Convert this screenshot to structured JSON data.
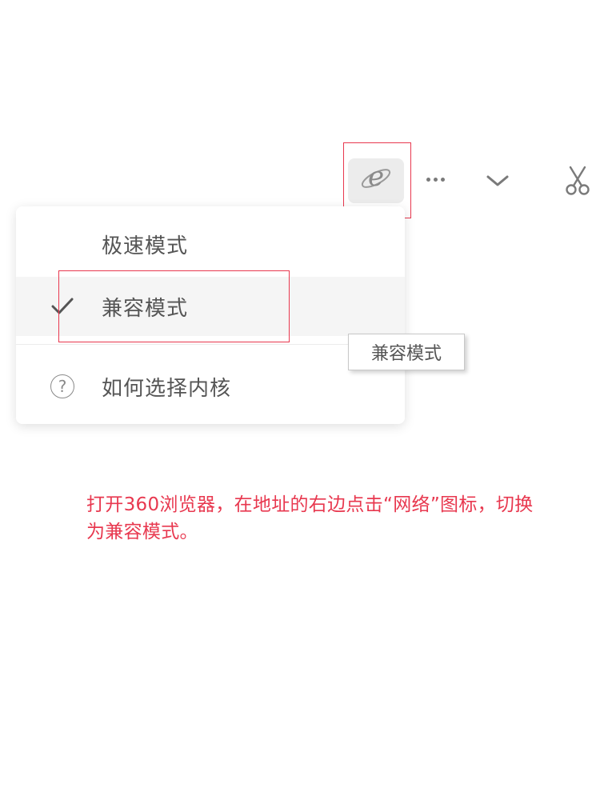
{
  "toolbar": {
    "ie_icon": "ie-compat-icon",
    "more_icon": "more-dots-icon",
    "dropdown_icon": "chevron-down-icon",
    "scissors_icon": "scissors-icon"
  },
  "menu": {
    "items": [
      {
        "label": "极速模式",
        "checked": false
      },
      {
        "label": "兼容模式",
        "checked": true,
        "icon": "checkmark-icon"
      },
      {
        "label": "如何选择内核",
        "icon": "help-circle-icon"
      }
    ]
  },
  "tooltip": {
    "text": "兼容模式"
  },
  "instruction": {
    "line1": "打开360浏览器，在地址的右边点击“网络”图标，切换",
    "line2": "为兼容模式。"
  },
  "colors": {
    "annotation": "#e8384f",
    "text": "#555555",
    "icon": "#7a7a7a",
    "hover_bg": "#f5f5f5",
    "button_bg": "#ececec"
  }
}
